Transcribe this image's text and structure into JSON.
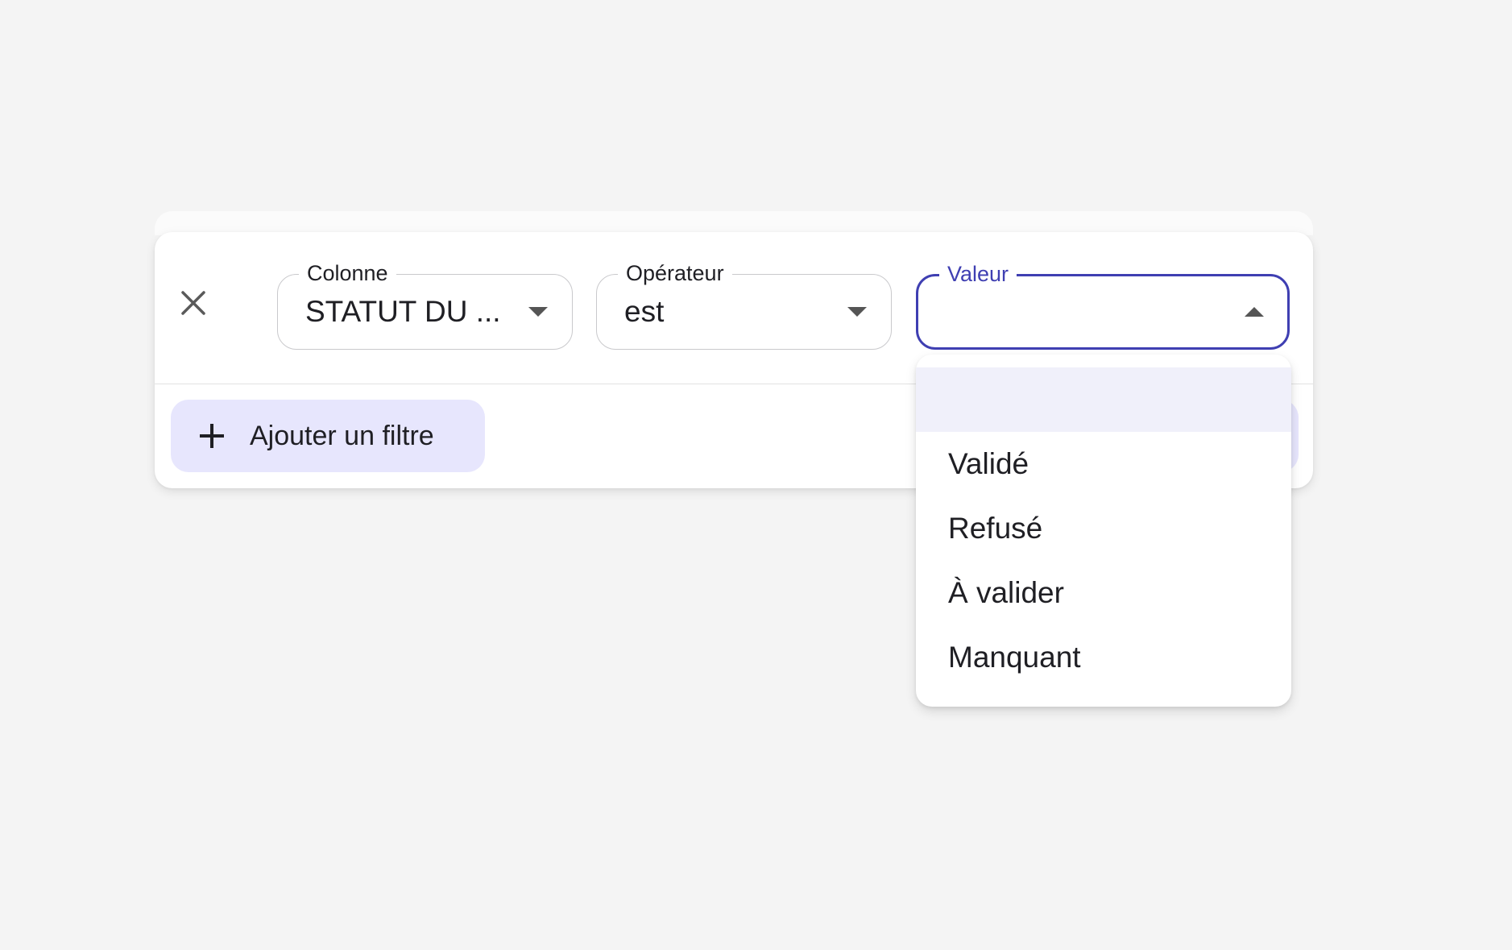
{
  "filter_panel": {
    "close_icon": "close-icon",
    "column_field": {
      "label": "Colonne",
      "value": "STATUT DU ..."
    },
    "operator_field": {
      "label": "Opérateur",
      "value": "est"
    },
    "value_field": {
      "label": "Valeur",
      "value": ""
    },
    "add_filter": {
      "icon": "plus-icon",
      "label": "Ajouter un filtre"
    }
  },
  "value_dropdown": {
    "options": [
      "",
      "Validé",
      "Refusé",
      "À valider",
      "Manquant"
    ],
    "highlighted_index": 0
  },
  "colors": {
    "accent": "#3f3fb2",
    "add_button_bg": "#e7e6fd",
    "highlight_bg": "#f0f0fa",
    "page_bg": "#f4f4f4"
  }
}
